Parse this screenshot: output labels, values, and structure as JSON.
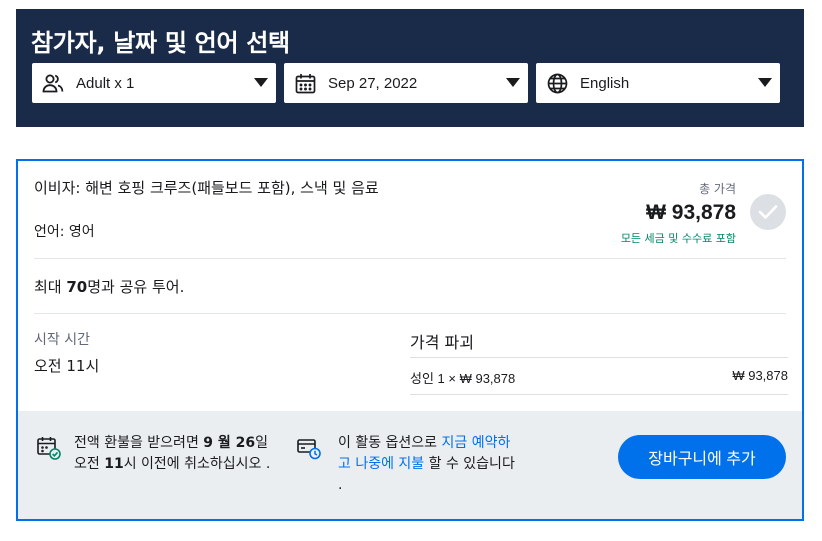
{
  "header": {
    "title": "참가자, 날짜 및 언어 선택",
    "participants": {
      "value": "Adult x 1",
      "icon": "people-icon"
    },
    "date": {
      "value": "Sep 27, 2022",
      "icon": "calendar-icon"
    },
    "language": {
      "value": "English",
      "icon": "globe-icon"
    }
  },
  "option": {
    "title": "이비자: 해변 호핑 크루즈(패들보드 포함), 스낵 및 음료",
    "language": "언어: 영어",
    "total_label": "총 가격",
    "total_price": "₩ 93,878",
    "tax_note": "모든 세금 및 수수료 포함",
    "shared_prefix": "최대 ",
    "shared_count": "70",
    "shared_suffix": "명과 공유 투어.",
    "start_label": "시작 시간",
    "start_value": "오전 11시",
    "price_breakdown": {
      "title": "가격 파괴",
      "rows": [
        {
          "label": "성인 1 × ₩ 93,878",
          "amount": "₩ 93,878"
        }
      ]
    }
  },
  "footer": {
    "refund_part1": "전액 환불을 받으려면 ",
    "refund_date": "9 월 26",
    "refund_part2": "일",
    "refund_line2a": "오전 ",
    "refund_time": "11",
    "refund_line2b": "시 이전에 취소하십시오 .",
    "reserve_part1": "이 활동 옵션으로 ",
    "reserve_link1": "지금 예약하",
    "reserve_link2": "고 나중에 지불",
    "reserve_part2": " 할 수 있습니다",
    "reserve_end": ".",
    "cart_button": "장바구니에 추가"
  },
  "colors": {
    "header_bg": "#1a2b49",
    "accent": "#0071eb",
    "tax_green": "#008768",
    "footer_bg": "#ebeef1"
  }
}
